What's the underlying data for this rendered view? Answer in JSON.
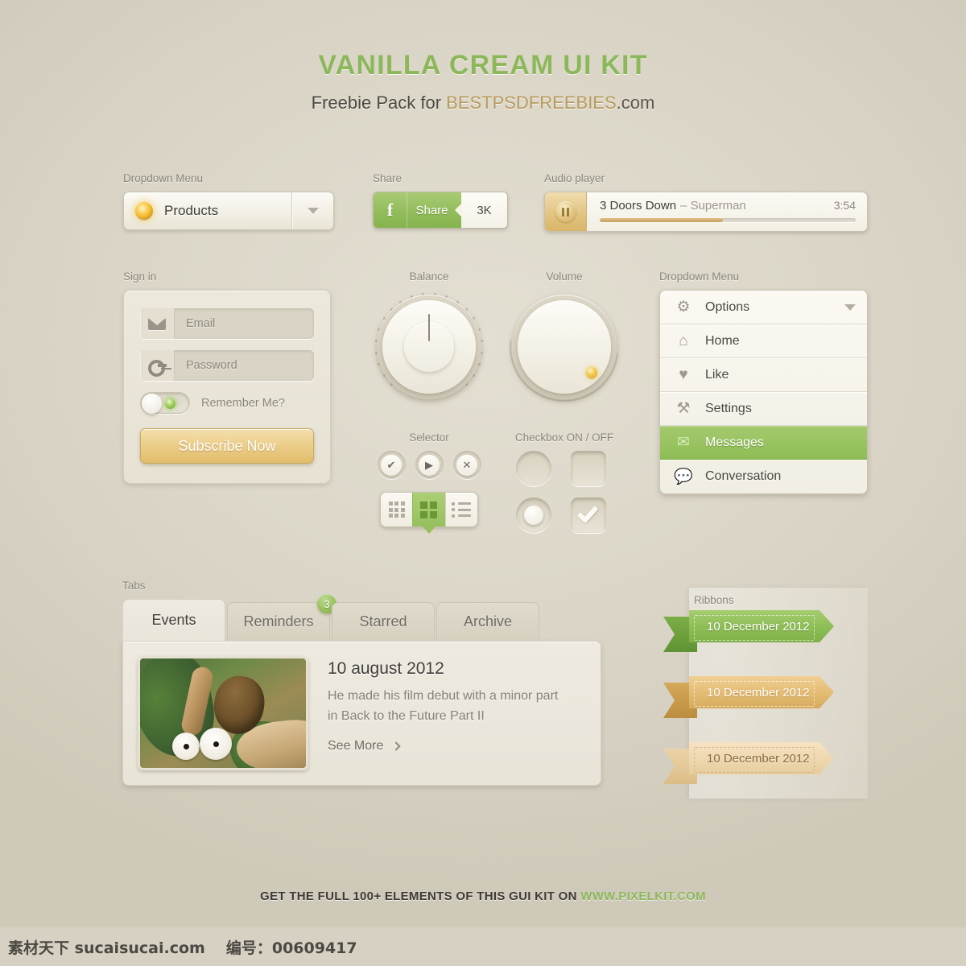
{
  "headline": {
    "title": "VANILLA CREAM UI KIT",
    "subtitle_prefix": "Freebie Pack for ",
    "subtitle_brand": "BESTPSDFREEBIES",
    "subtitle_suffix": ".com"
  },
  "dropdown_menu": {
    "caption": "Dropdown Menu",
    "selected": "Products",
    "arrow_icon": "chevron-down-icon"
  },
  "share": {
    "caption": "Share",
    "network_icon": "facebook-icon",
    "network_glyph": "f",
    "label": "Share",
    "count": "3K"
  },
  "audio": {
    "caption": "Audio player",
    "button_icon": "pause-icon",
    "artist": "3 Doors Down",
    "separator": "–",
    "track": "Superman",
    "duration": "3:54",
    "progress_percent": 48
  },
  "signin": {
    "caption": "Sign in",
    "email_placeholder": "Email",
    "email_icon": "envelope-icon",
    "password_placeholder": "Password",
    "password_icon": "key-icon",
    "remember_label": "Remember Me?",
    "remember_state": "off",
    "submit_label": "Subscribe Now"
  },
  "balance": {
    "caption": "Balance"
  },
  "volume": {
    "caption": "Volume"
  },
  "selector": {
    "caption": "Selector",
    "buttons": [
      {
        "icon": "check-icon",
        "glyph": "✔"
      },
      {
        "icon": "play-icon",
        "glyph": "▶"
      },
      {
        "icon": "close-icon",
        "glyph": "✕"
      }
    ],
    "segments": [
      {
        "icon": "grid-small-icon",
        "active": false
      },
      {
        "icon": "grid-large-icon",
        "active": true
      },
      {
        "icon": "list-icon",
        "active": false
      }
    ]
  },
  "checkbox": {
    "caption": "Checkbox ON / OFF",
    "items": [
      {
        "type": "radio",
        "state": "off"
      },
      {
        "type": "checkbox",
        "state": "off"
      },
      {
        "type": "radio",
        "state": "on"
      },
      {
        "type": "checkbox",
        "state": "on"
      }
    ]
  },
  "dropdown_list": {
    "caption": "Dropdown Menu",
    "items": [
      {
        "label": "Options",
        "icon": "gear-icon",
        "glyph": "⚙",
        "selected": false,
        "has_arrow": true
      },
      {
        "label": "Home",
        "icon": "home-icon",
        "glyph": "⌂",
        "selected": false,
        "has_arrow": false
      },
      {
        "label": "Like",
        "icon": "heart-icon",
        "glyph": "♥",
        "selected": false,
        "has_arrow": false
      },
      {
        "label": "Settings",
        "icon": "wrench-icon",
        "glyph": "⚒",
        "selected": false,
        "has_arrow": false
      },
      {
        "label": "Messages",
        "icon": "envelope-icon",
        "glyph": "✉",
        "selected": true,
        "has_arrow": false
      },
      {
        "label": "Conversation",
        "icon": "speech-bubble-icon",
        "glyph": "●",
        "selected": false,
        "has_arrow": false
      }
    ]
  },
  "tabs": {
    "caption": "Tabs",
    "items": [
      {
        "label": "Events",
        "active": true,
        "badge": null
      },
      {
        "label": "Reminders",
        "active": false,
        "badge": "3"
      },
      {
        "label": "Starred",
        "active": false,
        "badge": null
      },
      {
        "label": "Archive",
        "active": false,
        "badge": null
      }
    ],
    "panel": {
      "date": "10 august 2012",
      "description": "He made his film debut with a minor part in Back to the Future Part II",
      "more_label": "See More",
      "more_icon": "chevron-right-icon",
      "thumbnail_alt": "ice-age-scrat-thumbnail"
    }
  },
  "ribbons": {
    "caption": "Ribbons",
    "items": [
      {
        "label": "10 December 2012",
        "color": "#8dbd55",
        "variant": "green"
      },
      {
        "label": "10 December 2012",
        "color": "#e3bb72",
        "variant": "gold"
      },
      {
        "label": "10 December 2012",
        "color": "#eed7ae",
        "variant": "cream"
      }
    ]
  },
  "footer": {
    "text": "GET THE FULL 100+ ELEMENTS OF THIS GUI KIT ON ",
    "url": "WWW.PIXELKIT.COM"
  },
  "watermark": {
    "site_cn": "素材天下",
    "site": "sucaisucai.com",
    "id_label": "编号：",
    "id_value": "00609417"
  },
  "colors": {
    "green": "#8cb85b",
    "gold": "#b79b5e",
    "background": "#dcd7c9"
  }
}
